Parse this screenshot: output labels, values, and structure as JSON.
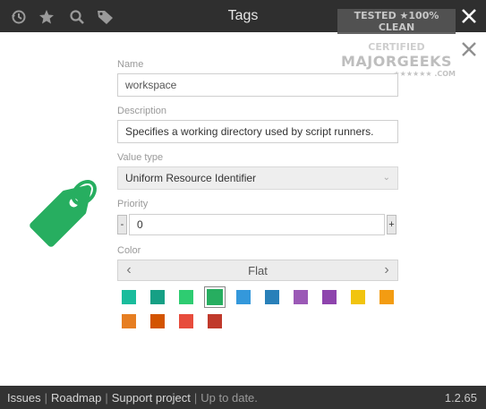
{
  "window": {
    "title": "Tags",
    "toolbar_icons": [
      "history-icon",
      "star-icon",
      "search-icon",
      "tag-icon"
    ]
  },
  "watermark": {
    "line1": "TESTED ★100% CLEAN",
    "line2": "CERTIFIED",
    "line3": "MAJORGEEKS",
    "line4": "★★★★★★ .COM"
  },
  "form": {
    "name_label": "Name",
    "name_value": "workspace",
    "description_label": "Description",
    "description_value": "Specifies a working directory used by script runners.",
    "value_type_label": "Value type",
    "value_type_value": "Uniform Resource Identifier",
    "priority_label": "Priority",
    "priority_minus": "-",
    "priority_value": "0",
    "priority_plus": "+",
    "color_label": "Color",
    "color_value": "Flat",
    "chev_left": "‹",
    "chev_right": "›"
  },
  "colors": {
    "accent": "#27ae60",
    "swatches": [
      "#1abc9c",
      "#16a085",
      "#2ecc71",
      "#27ae60",
      "#3498db",
      "#2980b9",
      "#9b59b6",
      "#8e44ad",
      "#f1c40f",
      "#f39c12",
      "#e67e22",
      "#d35400",
      "#e74c3c",
      "#c0392b"
    ],
    "selected_index": 3
  },
  "footer": {
    "issues": "Issues",
    "roadmap": "Roadmap",
    "support": "Support project",
    "status": "Up to date.",
    "version": "1.2.65",
    "sep": "|"
  }
}
